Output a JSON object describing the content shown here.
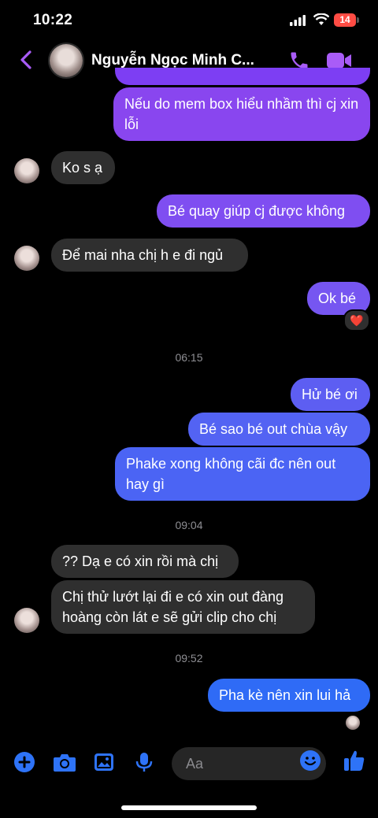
{
  "status_bar": {
    "time": "10:22",
    "battery": "14"
  },
  "header": {
    "contact_name": "Nguyễn Ngọc Minh C..."
  },
  "colors": {
    "accent": "#8d3ef0",
    "purple_bubble": "#8b44f0",
    "blue_bubble": "#3a5cf4",
    "incoming_bubble": "#2f2f2f"
  },
  "messages": [
    {
      "text": "Nếu do mem box hiểu nhầm thì cj xin lỗi",
      "dir": "out"
    },
    {
      "text": "Ko s ạ",
      "dir": "in"
    },
    {
      "text": "Bé quay giúp cj được không",
      "dir": "out"
    },
    {
      "text": "Để mai nha chị h e đi ngủ",
      "dir": "in"
    },
    {
      "text": "Ok bé",
      "dir": "out",
      "reaction": "❤️"
    },
    {
      "text": "Hử bé ơi",
      "dir": "out"
    },
    {
      "text": "Bé sao bé out chùa vậy",
      "dir": "out"
    },
    {
      "text": "Phake xong không cãi đc nên out hay gì",
      "dir": "out"
    },
    {
      "text": "?? Dạ e có xin rồi mà chị",
      "dir": "in"
    },
    {
      "text": "Chị thử lướt lại đi e có xin out đàng hoàng còn lát e sẽ gửi clip cho chị",
      "dir": "in"
    },
    {
      "text": "Pha kè nên xin lui hả",
      "dir": "out"
    }
  ],
  "timestamps": [
    "06:15",
    "09:04",
    "09:52"
  ],
  "composer": {
    "placeholder": "Aa"
  },
  "icons": [
    "back-icon",
    "phone-icon",
    "video-icon",
    "plus-icon",
    "camera-icon",
    "image-icon",
    "mic-icon",
    "emoji-icon",
    "like-icon"
  ]
}
